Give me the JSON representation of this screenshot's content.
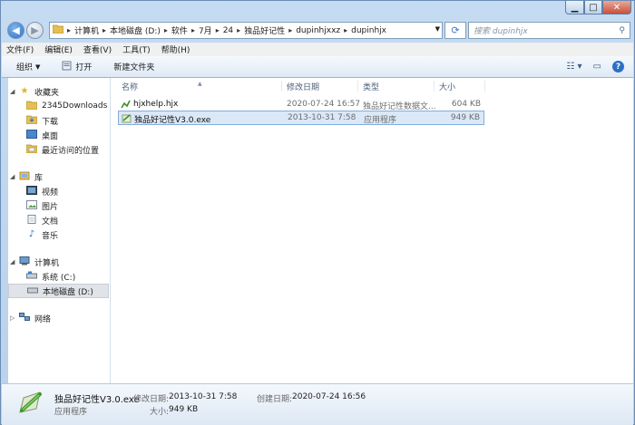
{
  "window": {
    "address": [
      "计算机",
      "本地磁盘 (D:)",
      "软件",
      "7月",
      "24",
      "独品好记性",
      "dupinhjxxz",
      "dupinhjx"
    ],
    "search_placeholder": "搜索 dupinhjx"
  },
  "menu": [
    "文件(F)",
    "编辑(E)",
    "查看(V)",
    "工具(T)",
    "帮助(H)"
  ],
  "commands": {
    "organize": "组织",
    "open": "打开",
    "new_folder": "新建文件夹"
  },
  "sidebar": {
    "favorites": {
      "label": "收藏夹",
      "items": [
        "2345Downloads",
        "下载",
        "桌面",
        "最近访问的位置"
      ]
    },
    "libraries": {
      "label": "库",
      "items": [
        "视频",
        "图片",
        "文档",
        "音乐"
      ]
    },
    "computer": {
      "label": "计算机",
      "items": [
        "系统 (C:)",
        "本地磁盘 (D:)"
      ]
    },
    "network": {
      "label": "网络"
    }
  },
  "columns": {
    "name": "名称",
    "modified": "修改日期",
    "type": "类型",
    "size": "大小"
  },
  "files": [
    {
      "name": "hjxhelp.hjx",
      "modified": "2020-07-24 16:57",
      "type": "独品好记性数据文...",
      "size": "604 KB"
    },
    {
      "name": "独品好记性V3.0.exe",
      "modified": "2013-10-31 7:58",
      "type": "应用程序",
      "size": "949 KB"
    }
  ],
  "details": {
    "filename": "独品好记性V3.0.exe",
    "type": "应用程序",
    "modified_label": "修改日期:",
    "modified": "2013-10-31 7:58",
    "created_label": "创建日期:",
    "created": "2020-07-24 16:56",
    "size_label": "大小:",
    "size": "949 KB"
  }
}
